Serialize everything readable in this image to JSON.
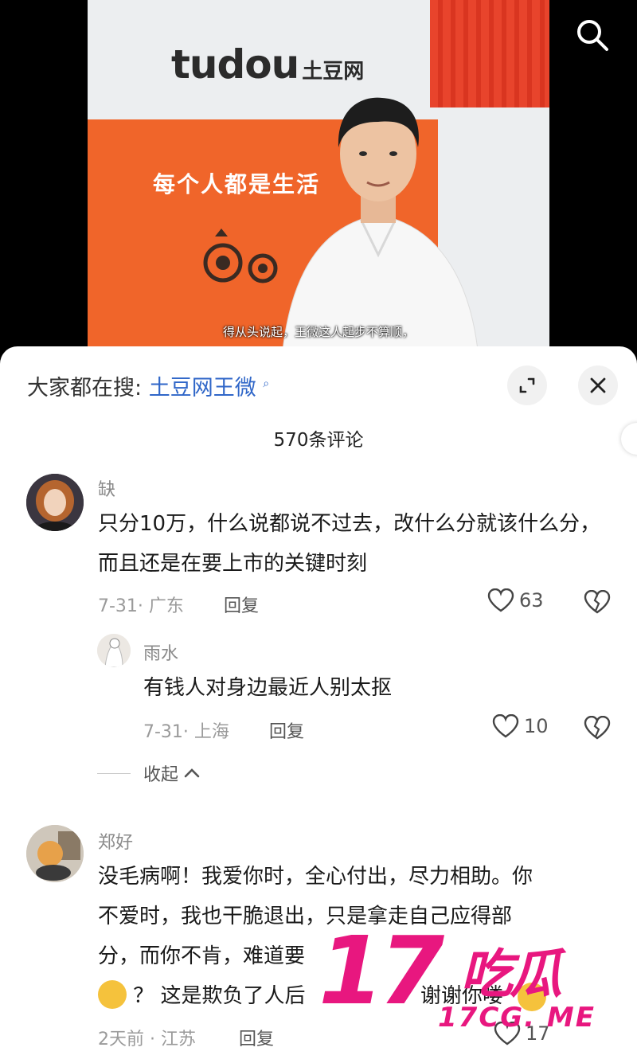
{
  "video": {
    "logo_brand": "tudou",
    "logo_cn": "土豆网",
    "banner_slogan": "每个人都是生活",
    "subtitle": "得从头说起，王微这人起步不算顺，"
  },
  "panel": {
    "hot_search_prefix": "大家都在搜:",
    "hot_search_term": "土豆网王微",
    "comment_count": "570条评论",
    "collapse_label": "收起"
  },
  "comments": [
    {
      "user": "缺",
      "text": "只分10万，什么说都说不过去，改什么分就该什么分，而且还是在要上市的关键时刻",
      "meta": "7-31· 广东",
      "reply_label": "回复",
      "likes": "63"
    },
    {
      "user": "郑好",
      "text_line1": "没毛病啊！我爱你时，全心付出，尽力相助。你",
      "text_line2": "不爱时，我也干脆退出，只是拿走自己应得部",
      "text_line3": "分，而你不肯，难道要",
      "text_line4": "？ 这是欺负了人后",
      "text_line4_tail": "谢谢你喽",
      "meta": "2天前 · 江苏",
      "reply_label": "回复",
      "likes": "17"
    }
  ],
  "replies": [
    {
      "user": "雨水",
      "text": "有钱人对身边最近人别太抠",
      "meta": "7-31· 上海",
      "reply_label": "回复",
      "likes": "10"
    }
  ],
  "watermark": {
    "number": "17",
    "cn": "吃瓜",
    "url": "17CG. ME"
  },
  "colors": {
    "accent_link": "#2f66c8",
    "banner_orange": "#f0652a",
    "watermark_pink": "#e8177f"
  }
}
